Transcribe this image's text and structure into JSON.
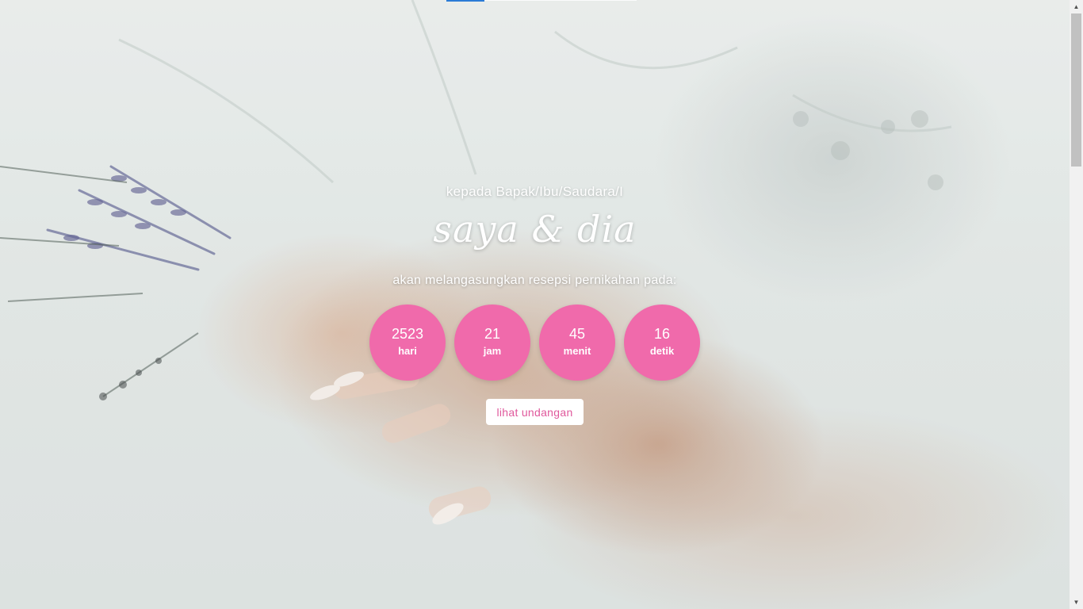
{
  "header": {
    "greeting": "kepada Bapak/Ibu/Saudara/I",
    "couple": "saya & dia",
    "announcement": "akan melangasungkan resepsi pernikahan pada:"
  },
  "countdown": [
    {
      "value": "2523",
      "unit": "hari"
    },
    {
      "value": "21",
      "unit": "jam"
    },
    {
      "value": "45",
      "unit": "menit"
    },
    {
      "value": "16",
      "unit": "detik"
    }
  ],
  "cta": {
    "label": "lihat undangan"
  },
  "scrollbar": {
    "up_icon": "▲",
    "down_icon": "▼",
    "position_fraction": 0.0
  },
  "colors": {
    "accent_pink": "#f06aab",
    "button_text_pink": "#e0589c",
    "top_accent_blue": "#2b7bd6"
  }
}
